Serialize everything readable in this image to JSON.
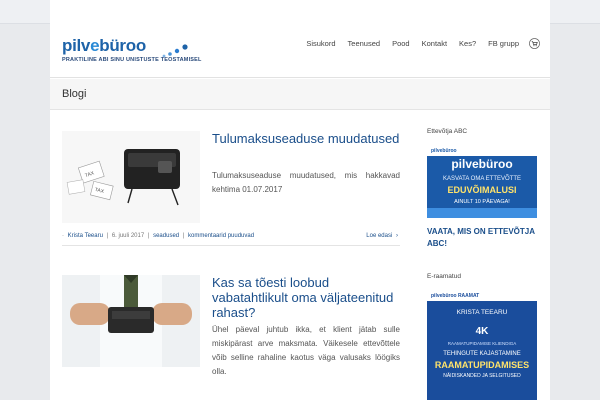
{
  "header": {
    "logo": {
      "word_a": "pilv",
      "word_b": "büroo",
      "tagline": "PRAKTILINE ABI SINU UNISTUSTE TEOSTAMISEL"
    },
    "nav": [
      "Sisukord",
      "Teenused",
      "Pood",
      "Kontakt",
      "Kes?",
      "FB grupp"
    ],
    "cart_icon": "cart-icon"
  },
  "page_title": "Blogi",
  "posts": [
    {
      "title": "Tulumaksuseaduse muudatused",
      "excerpt": "Tulumaksuseaduse muudatused, mis hakkavad kehtima 01.07.2017",
      "thumb_labels": [
        "TAX",
        "TAX"
      ],
      "meta": {
        "author": "Krista Teearu",
        "date": "6. juuli 2017",
        "category": "seadused",
        "comments": "kommentaarid puuduvad",
        "read_more": "Loe edasi"
      }
    },
    {
      "title": "Kas sa tõesti loobud vabatahtlikult oma väljateenitud rahast?",
      "excerpt": "Ühel päeval juhtub ikka, et klient jätab sulle miskipärast arve maksmata. Väikesele ettevõttele võib selline rahaline kaotus väga valusaks löögiks olla."
    }
  ],
  "sidebar": {
    "widget1_title": "Ettevõtja ABC",
    "banner1": {
      "brand": "pilvebüroo",
      "line1": "KASVATA OMA ETTEVÕTTE",
      "line2": "EDUVÕIMALUSI",
      "line3": "AINULT 10 PÄEVAGA!"
    },
    "link1": "VAATA, MIS ON ETTEVÕTJA ABC!",
    "widget2_title": "E-raamatud",
    "banner2": {
      "top": "pilvebüroo RAAMAT",
      "name": "KRISTA TEEARU",
      "badge": "4K",
      "sub": "RAAMATUPIDAMISE KLIENDIGA",
      "line1": "TEHINGUTE KAJASTAMINE",
      "line2": "RAAMATUPIDAMISES",
      "line3": "NÄIDISKANDED JA SELGITUSED"
    }
  },
  "colors": {
    "brand_blue": "#1e63a8",
    "title_blue": "#1a4e8a",
    "banner_blue": "#1b5aa8",
    "highlight_yellow": "#ffe36a"
  }
}
